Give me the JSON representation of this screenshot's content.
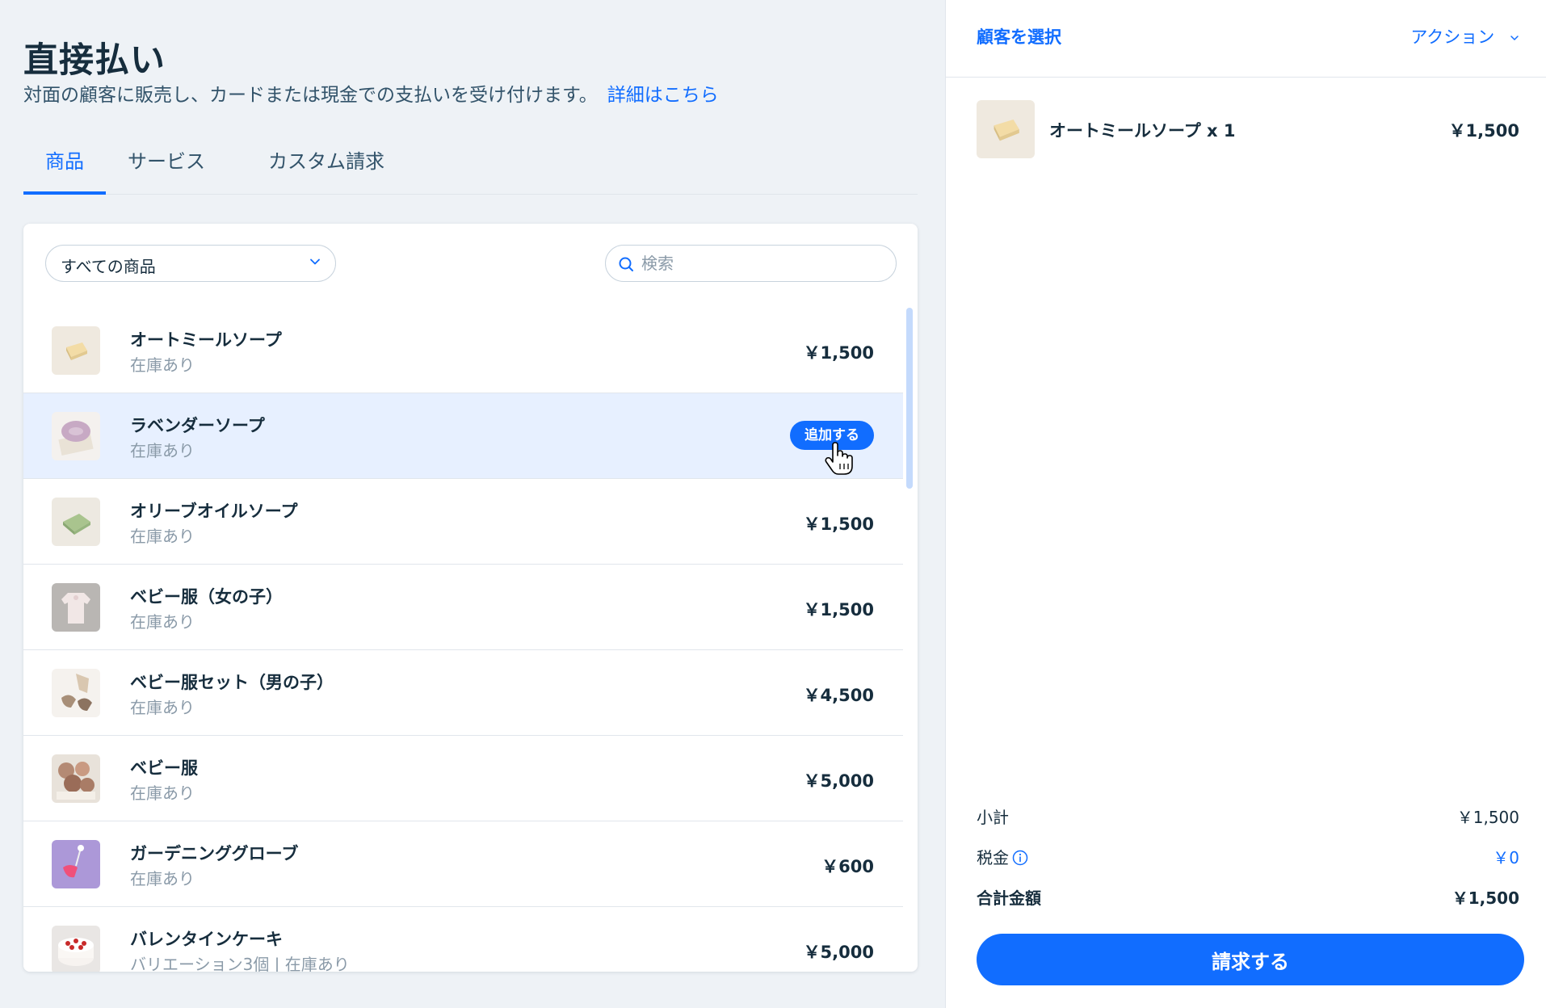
{
  "page": {
    "title": "直接払い",
    "subtitle": "対面の顧客に販売し、カードまたは現金での支払いを受け付けます。",
    "subtitle_link": "詳細はこちら"
  },
  "tabs": [
    {
      "label": "商品",
      "active": true
    },
    {
      "label": "サービス",
      "active": false
    },
    {
      "label": "カスタム請求",
      "active": false
    }
  ],
  "filter": {
    "selected": "すべての商品"
  },
  "search": {
    "placeholder": "検索",
    "value": ""
  },
  "products": [
    {
      "name": "オートミールソープ",
      "stock": "在庫あり",
      "price": "￥1,500",
      "thumb": "oatmeal-soap"
    },
    {
      "name": "ラベンダーソープ",
      "stock": "在庫あり",
      "price": "",
      "hover": true,
      "add_label": "追加する",
      "thumb": "lavender-soap"
    },
    {
      "name": "オリーブオイルソープ",
      "stock": "在庫あり",
      "price": "￥1,500",
      "thumb": "olive-soap"
    },
    {
      "name": "ベビー服（女の子）",
      "stock": "在庫あり",
      "price": "￥1,500",
      "thumb": "baby-girl"
    },
    {
      "name": "ベビー服セット（男の子）",
      "stock": "在庫あり",
      "price": "￥4,500",
      "thumb": "baby-boy-set"
    },
    {
      "name": "ベビー服",
      "stock": "在庫あり",
      "price": "￥5,000",
      "thumb": "baby-clothes"
    },
    {
      "name": "ガーデニンググローブ",
      "stock": "在庫あり",
      "price": "￥600",
      "thumb": "garden-glove"
    },
    {
      "name": "バレンタインケーキ",
      "stock": "バリエーション3個 | 在庫あり",
      "price": "￥5,000",
      "thumb": "cake"
    }
  ],
  "cart": {
    "select_customer": "顧客を選択",
    "actions": "アクション",
    "items": [
      {
        "name": "オートミールソープ x 1",
        "price": "￥1,500"
      }
    ],
    "subtotal_label": "小計",
    "subtotal": "￥1,500",
    "tax_label": "税金",
    "tax": "￥0",
    "total_label": "合計金額",
    "total": "￥1,500",
    "charge_label": "請求する"
  },
  "colors": {
    "accent": "#116dff",
    "hover_row": "#e7f0ff",
    "text": "#162d3d",
    "muted": "#8a9aa8"
  }
}
